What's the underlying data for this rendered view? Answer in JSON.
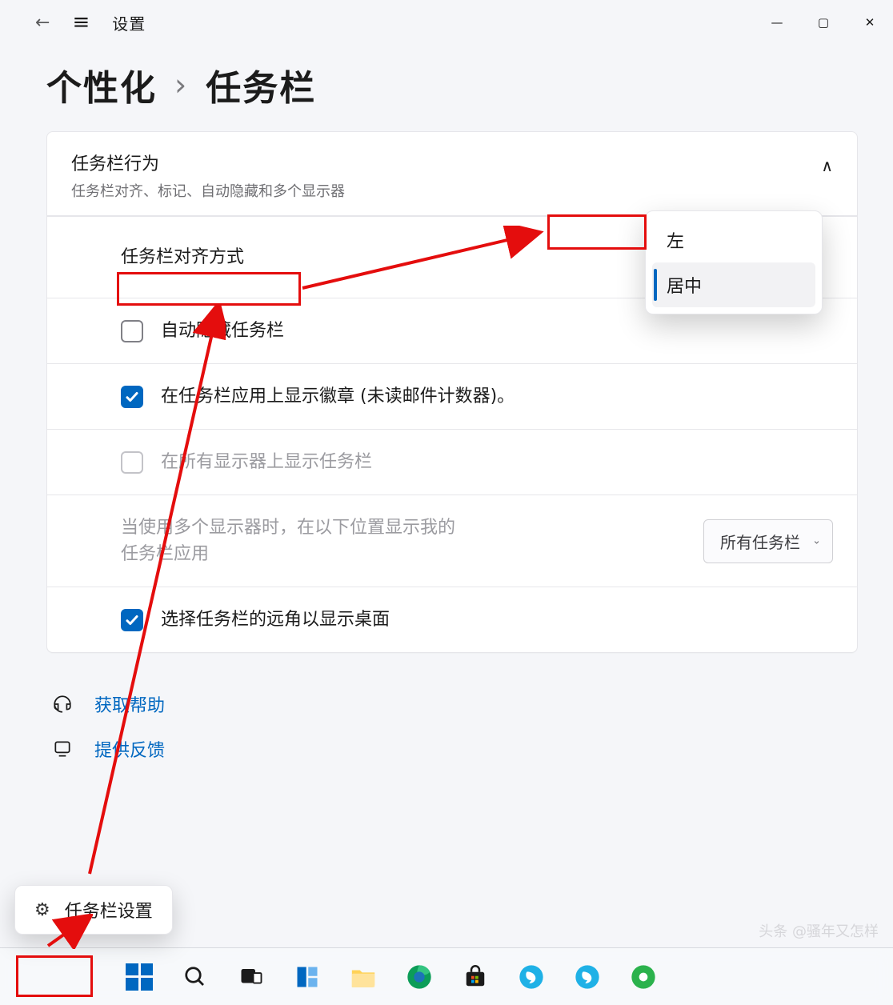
{
  "window": {
    "app_title": "设置",
    "minimize": "—",
    "maximize": "▢",
    "close": "✕"
  },
  "breadcrumb": {
    "parent": "个性化",
    "sep": "›",
    "current": "任务栏"
  },
  "section": {
    "title": "任务栏行为",
    "subtitle": "任务栏对齐、标记、自动隐藏和多个显示器",
    "rows": {
      "alignment_label": "任务栏对齐方式",
      "auto_hide": "自动隐藏任务栏",
      "badges": "在任务栏应用上显示徽章 (未读邮件计数器)。",
      "all_monitors": "在所有显示器上显示任务栏",
      "multi_mon_label": "当使用多个显示器时，在以下位置显示我的任务栏应用",
      "multi_mon_value": "所有任务栏",
      "show_desktop": "选择任务栏的远角以显示桌面"
    }
  },
  "alignment_options": {
    "left": "左",
    "center": "居中"
  },
  "help": {
    "get_help": "获取帮助",
    "feedback": "提供反馈"
  },
  "context_menu": {
    "taskbar_settings": "任务栏设置"
  },
  "watermark": "头条 @骚年又怎样"
}
